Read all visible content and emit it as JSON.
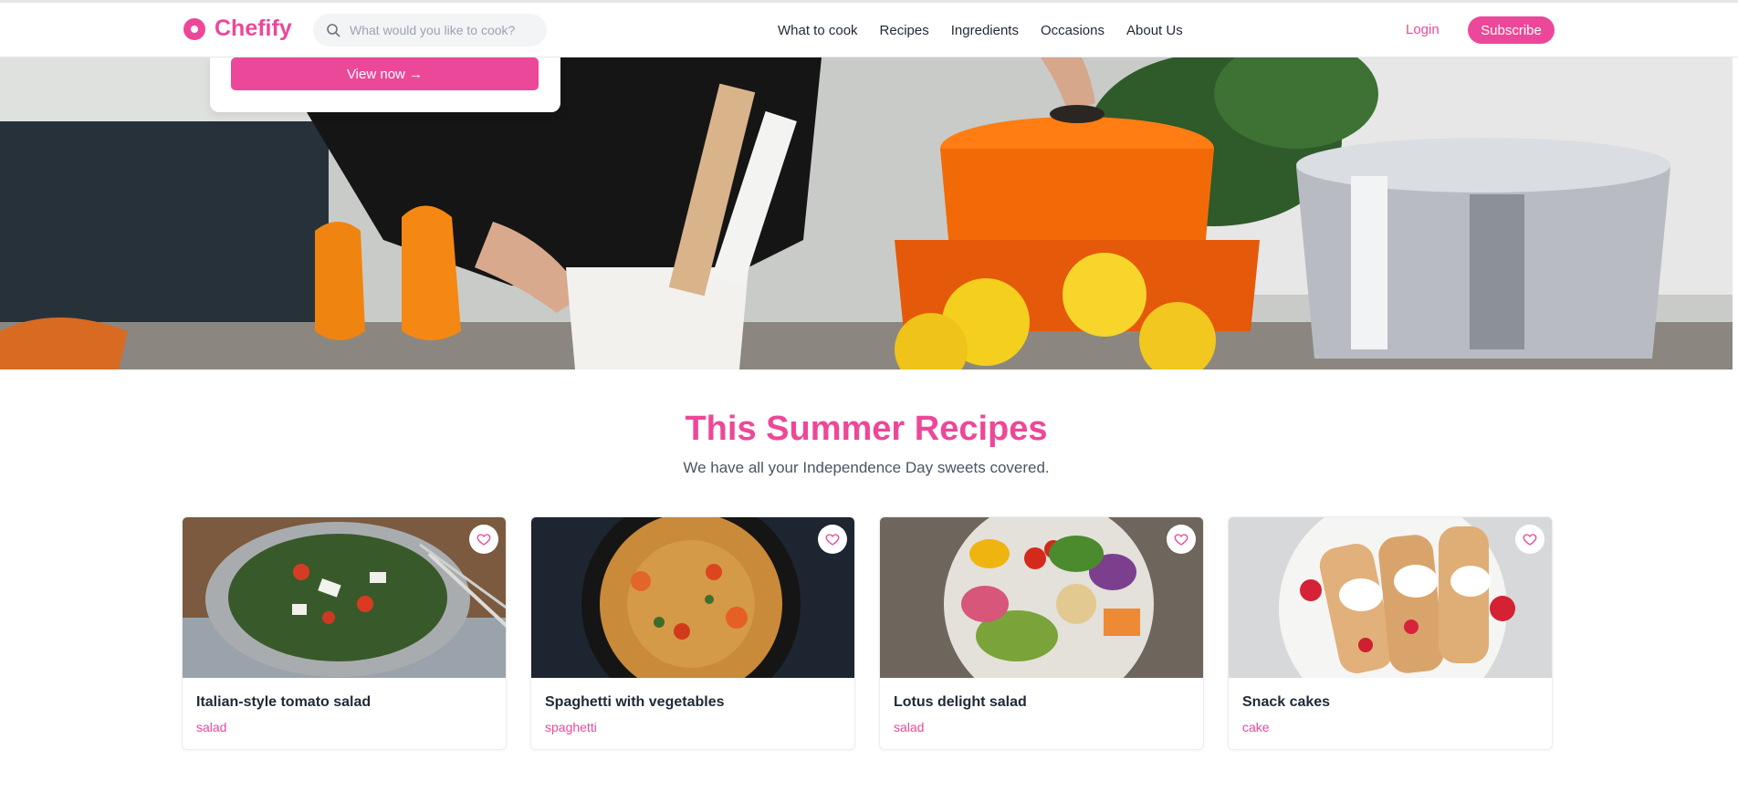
{
  "header": {
    "brand": "Chefify",
    "search_placeholder": "What would you like to cook?",
    "nav": [
      "What to cook",
      "Recipes",
      "Ingredients",
      "Occasions",
      "About Us"
    ],
    "login_label": "Login",
    "subscribe_label": "Subscribe"
  },
  "hero": {
    "button_label": "View now →"
  },
  "section": {
    "title": "This Summer Recipes",
    "subtitle": "We have all your Independence Day sweets covered."
  },
  "cards": [
    {
      "title": "Italian-style tomato salad",
      "tag": "salad"
    },
    {
      "title": "Spaghetti with vegetables",
      "tag": "spaghetti"
    },
    {
      "title": "Lotus delight salad",
      "tag": "salad"
    },
    {
      "title": "Snack cakes",
      "tag": "cake"
    }
  ],
  "colors": {
    "accent": "#ec4899",
    "text": "#1f2937",
    "muted": "#4b5563"
  },
  "icons": {
    "search": "search-icon",
    "favorite": "heart-icon",
    "logo": "logo-icon"
  }
}
